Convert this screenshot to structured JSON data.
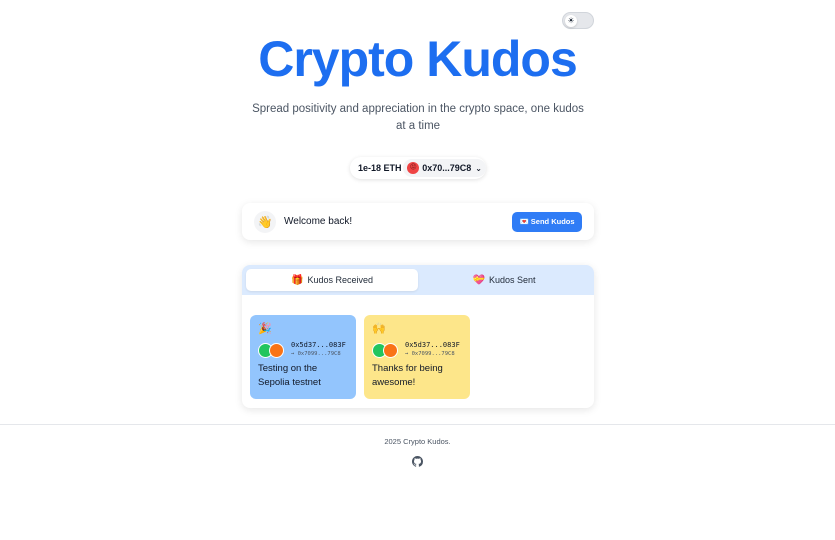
{
  "header": {
    "title": "Crypto Kudos",
    "subtitle": "Spread positivity and appreciation in the crypto space, one kudos at a time",
    "theme_icon": "☀"
  },
  "wallet": {
    "balance": "1e-18 ETH",
    "account": "0x70...79C8",
    "avatar_emoji": "😡",
    "chevron": "⌄"
  },
  "welcome": {
    "emoji": "👋",
    "text": "Welcome back!",
    "send_icon": "💌",
    "send_label": "Send Kudos"
  },
  "tabs": [
    {
      "icon": "🎁",
      "label": "Kudos Received",
      "active": true
    },
    {
      "icon": "💝",
      "label": "Kudos Sent",
      "active": false
    }
  ],
  "kudos": [
    {
      "emoji": "🎉",
      "from": "0x5d37...083F",
      "to": "→ 0x7099...79C8",
      "message": "Testing on the Sepolia testnet",
      "color": "#93c5fd"
    },
    {
      "emoji": "🙌",
      "from": "0x5d37...083F",
      "to": "→ 0x7099...79C8",
      "message": "Thanks for being awesome!",
      "color": "#fde68a"
    }
  ],
  "footer": {
    "text": "2025 Crypto Kudos.",
    "github_icon": "github-icon"
  },
  "colors": {
    "accent": "#1d6ef0",
    "button": "#2f7cf6",
    "tab_bar": "#dbeafe"
  }
}
